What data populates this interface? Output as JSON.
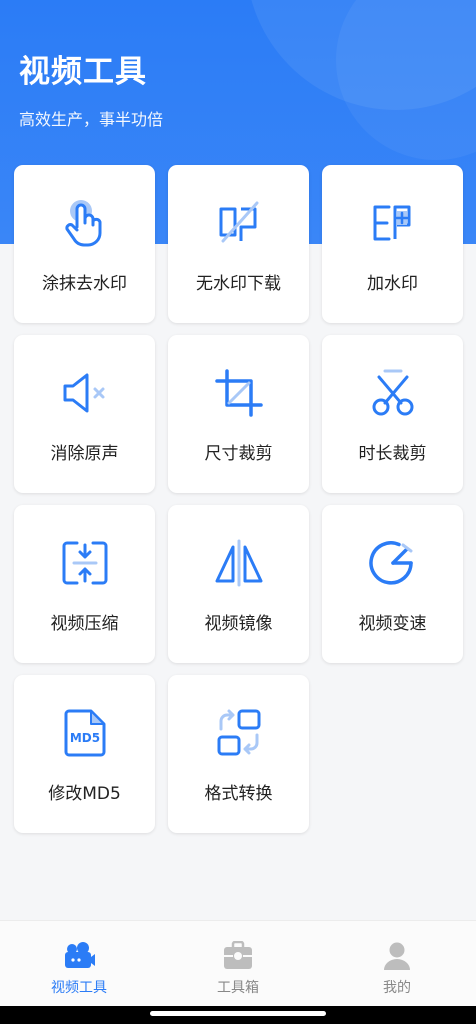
{
  "header": {
    "title": "视频工具",
    "subtitle": "高效生产，事半功倍"
  },
  "tools": [
    {
      "label": "涂抹去水印",
      "icon": "tap-finger-icon"
    },
    {
      "label": "无水印下载",
      "icon": "no-watermark-icon"
    },
    {
      "label": "加水印",
      "icon": "add-watermark-icon"
    },
    {
      "label": "消除原声",
      "icon": "mute-icon"
    },
    {
      "label": "尺寸裁剪",
      "icon": "crop-icon"
    },
    {
      "label": "时长裁剪",
      "icon": "scissors-icon"
    },
    {
      "label": "视频压缩",
      "icon": "compress-icon"
    },
    {
      "label": "视频镜像",
      "icon": "mirror-icon"
    },
    {
      "label": "视频变速",
      "icon": "speed-gauge-icon"
    },
    {
      "label": "修改MD5",
      "icon": "md5-file-icon"
    },
    {
      "label": "格式转换",
      "icon": "format-convert-icon"
    }
  ],
  "tabbar": {
    "items": [
      {
        "label": "视频工具",
        "icon": "video-tools-icon",
        "active": true
      },
      {
        "label": "工具箱",
        "icon": "toolbox-icon",
        "active": false
      },
      {
        "label": "我的",
        "icon": "profile-icon",
        "active": false
      }
    ]
  },
  "colors": {
    "accent": "#2b7cf6",
    "icon_light": "#a9c8f7",
    "inactive": "#b9b9b9"
  }
}
